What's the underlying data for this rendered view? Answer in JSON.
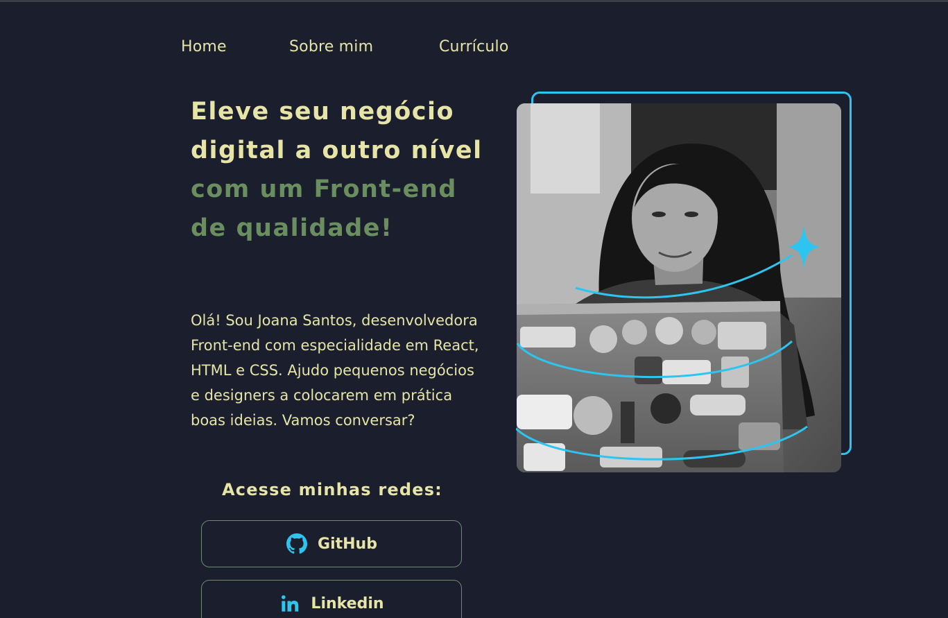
{
  "nav": {
    "items": [
      {
        "label": "Home"
      },
      {
        "label": "Sobre mim"
      },
      {
        "label": "Currículo"
      }
    ]
  },
  "hero": {
    "headline_highlight": "Eleve seu negócio digital a outro nível",
    "headline_rest": " com um Front-end de qualidade!",
    "intro": "Olá! Sou Joana Santos, desenvolvedora Front-end com especialidade em React, HTML e CSS. Ajudo pequenos negócios e designers a colocarem em prática boas ideias. Vamos conversar?",
    "photo_alt": "Joana Santos"
  },
  "social": {
    "title": "Acesse minhas redes:",
    "links": [
      {
        "label": "GitHub",
        "icon": "github-icon"
      },
      {
        "label": "Linkedin",
        "icon": "linkedin-icon"
      }
    ]
  },
  "colors": {
    "background": "#1b1f2d",
    "primary_text": "#e6e4a6",
    "accent_green": "#6a8e5f",
    "accent_blue": "#2ec4f0",
    "button_border": "#6f8a72"
  }
}
